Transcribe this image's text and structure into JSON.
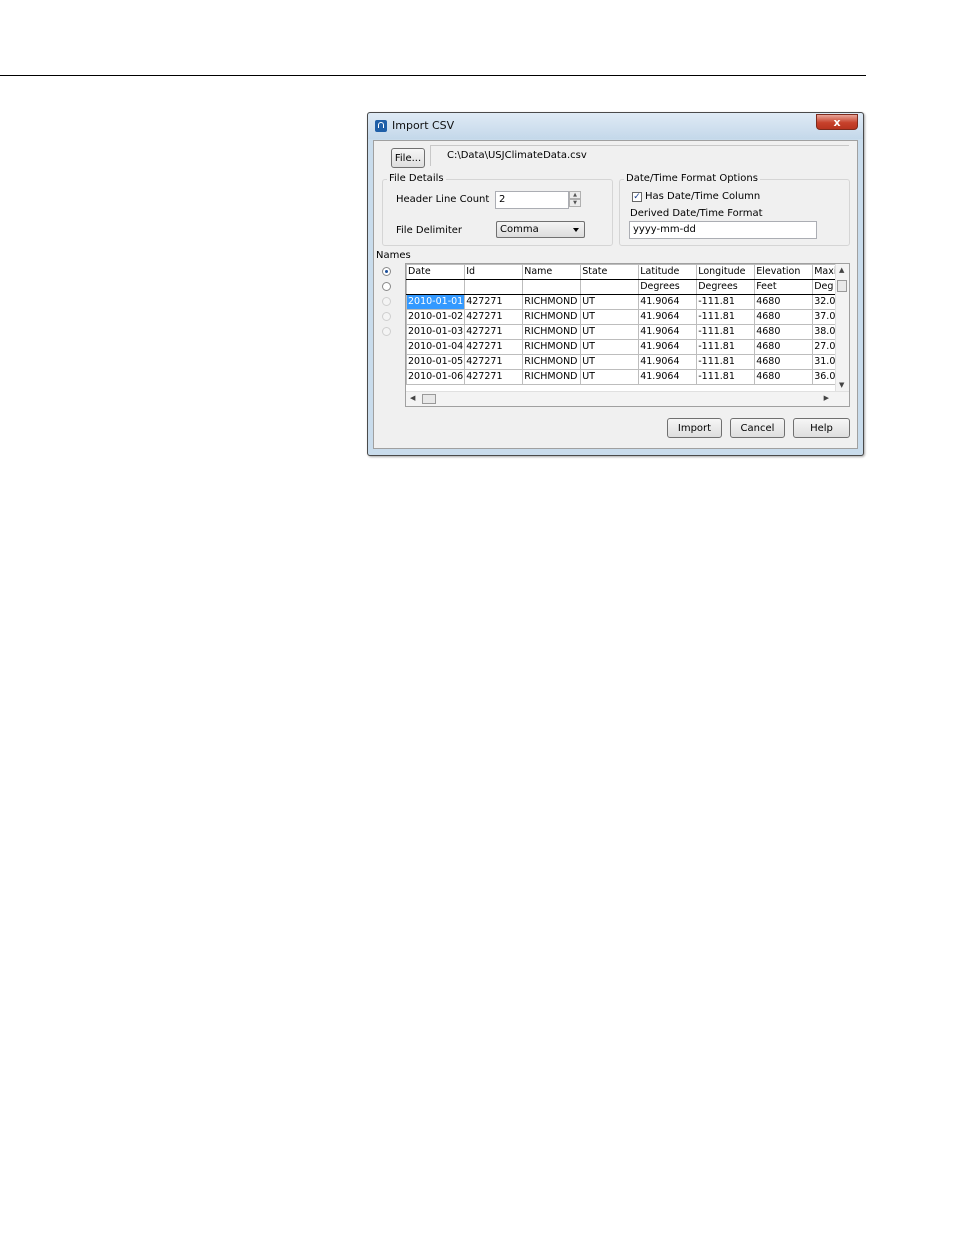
{
  "window": {
    "title": "Import CSV",
    "close_glyph": "x"
  },
  "file": {
    "button_label": "File...",
    "path": "C:\\Data\\USJClimateData.csv"
  },
  "file_details": {
    "group_label": "File Details",
    "header_line_count_label": "Header Line Count",
    "header_line_count_value": "2",
    "delimiter_label": "File Delimiter",
    "delimiter_value": "Comma"
  },
  "datetime_options": {
    "group_label": "Date/Time Format Options",
    "has_column_label": "Has Date/Time Column",
    "has_column_checked": true,
    "derived_format_label": "Derived Date/Time Format",
    "derived_format_value": "yyyy-mm-dd"
  },
  "names_label": "Names",
  "grid": {
    "columns": [
      "Date",
      "Id",
      "Name",
      "State",
      "Latitude",
      "Longitude",
      "Elevation",
      "Maxi"
    ],
    "units": [
      "",
      "",
      "",
      "",
      "Degrees",
      "Degrees",
      "Feet",
      "Deg"
    ],
    "rows": [
      [
        "2010-01-01",
        "427271",
        "RICHMOND",
        "UT",
        "41.9064",
        "-111.81",
        "4680",
        "32.0"
      ],
      [
        "2010-01-02",
        "427271",
        "RICHMOND",
        "UT",
        "41.9064",
        "-111.81",
        "4680",
        "37.0"
      ],
      [
        "2010-01-03",
        "427271",
        "RICHMOND",
        "UT",
        "41.9064",
        "-111.81",
        "4680",
        "38.0"
      ],
      [
        "2010-01-04",
        "427271",
        "RICHMOND",
        "UT",
        "41.9064",
        "-111.81",
        "4680",
        "27.0"
      ],
      [
        "2010-01-05",
        "427271",
        "RICHMOND",
        "UT",
        "41.9064",
        "-111.81",
        "4680",
        "31.0"
      ],
      [
        "2010-01-06",
        "427271",
        "RICHMOND",
        "UT",
        "41.9064",
        "-111.81",
        "4680",
        "36.0"
      ]
    ],
    "selected_cell": "2010-01-01"
  },
  "buttons": {
    "import": "Import",
    "cancel": "Cancel",
    "help": "Help"
  },
  "icons": {
    "app": "app-icon",
    "close": "close-icon"
  },
  "colors": {
    "titlebar": "#c4d8ea",
    "close": "#c7412b",
    "selection": "#3399ff"
  }
}
